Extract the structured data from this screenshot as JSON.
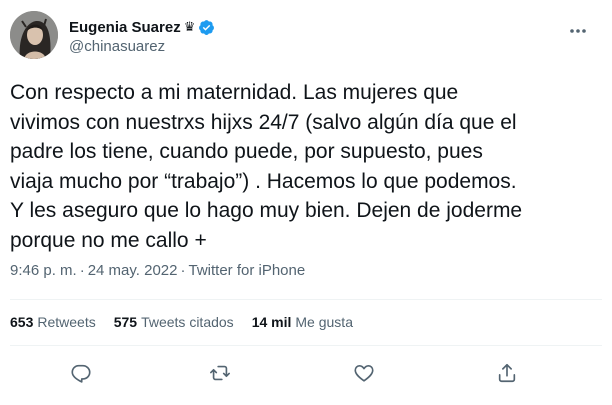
{
  "author": {
    "display_name": "Eugenia Suarez",
    "name_emoji": "♛",
    "handle": "@chinasuarez",
    "verified": true,
    "avatar_icon": "avatar-photo"
  },
  "tweet": {
    "text": "Con respecto a mi maternidad. Las mujeres que\nvivimos con nuestrxs hijxs 24/7 (salvo algún día que el\npadre los tiene, cuando puede, por supuesto, pues\nviaja mucho por “trabajo”) . Hacemos lo que podemos.\nY les aseguro que lo hago muy bien. Dejen de joderme\nporque no me callo +",
    "time": "9:46 p. m.",
    "separator": "·",
    "date": "24 may. 2022",
    "source": "Twitter for iPhone"
  },
  "stats": {
    "retweets_count": "653",
    "retweets_label": "Retweets",
    "quotes_count": "575",
    "quotes_label": "Tweets citados",
    "likes_count": "14 mil",
    "likes_label": "Me gusta"
  },
  "actions": {
    "reply_icon": "reply-icon",
    "retweet_icon": "retweet-icon",
    "like_icon": "like-icon",
    "share_icon": "share-icon"
  },
  "colors": {
    "text": "#0f1419",
    "muted": "#536471",
    "verified": "#1d9bf0",
    "divider": "#eff3f4"
  }
}
